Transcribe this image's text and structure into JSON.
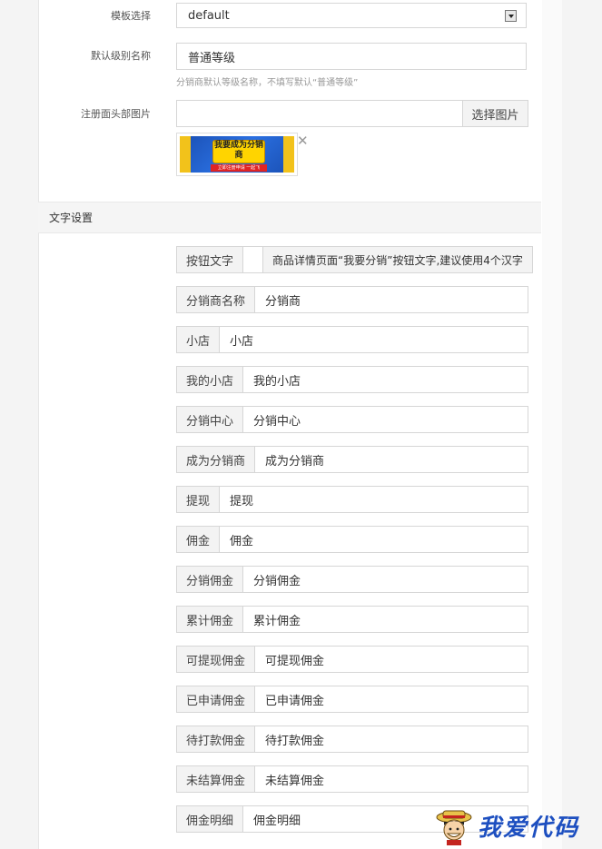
{
  "form": {
    "template_label": "模板选择",
    "template_value": "default",
    "default_level_label": "默认级别名称",
    "default_level_value": "普通等级",
    "default_level_help": "分销商默认等级名称，不填写默认“普通等级”",
    "header_image_label": "注册面头部图片",
    "choose_image_button": "选择图片",
    "thumb_title": "我要成为分销商",
    "thumb_ribbon": "立即注册申请 一起飞"
  },
  "section": {
    "title": "文字设置"
  },
  "text_settings": {
    "button_text": {
      "label": "按钮文字",
      "value": "",
      "tip": "商品详情页面“我要分销”按钮文字,建议使用4个汉字"
    },
    "rows": [
      {
        "label": "分销商名称",
        "value": "分销商"
      },
      {
        "label": "小店",
        "value": "小店"
      },
      {
        "label": "我的小店",
        "value": "我的小店"
      },
      {
        "label": "分销中心",
        "value": "分销中心"
      },
      {
        "label": "成为分销商",
        "value": "成为分销商"
      },
      {
        "label": "提现",
        "value": "提现"
      },
      {
        "label": "佣金",
        "value": "佣金"
      },
      {
        "label": "分销佣金",
        "value": "分销佣金"
      },
      {
        "label": "累计佣金",
        "value": "累计佣金"
      },
      {
        "label": "可提现佣金",
        "value": "可提现佣金"
      },
      {
        "label": "已申请佣金",
        "value": "已申请佣金"
      },
      {
        "label": "待打款佣金",
        "value": "待打款佣金"
      },
      {
        "label": "未结算佣金",
        "value": "未结算佣金"
      },
      {
        "label": "佣金明细",
        "value": "佣金明细"
      }
    ]
  },
  "watermark": {
    "text": "我爱代码"
  },
  "colors": {
    "watermark_blue": "#1d4fc0",
    "thumb_blue": "#1a4fb3",
    "thumb_yellow": "#ffd400"
  }
}
